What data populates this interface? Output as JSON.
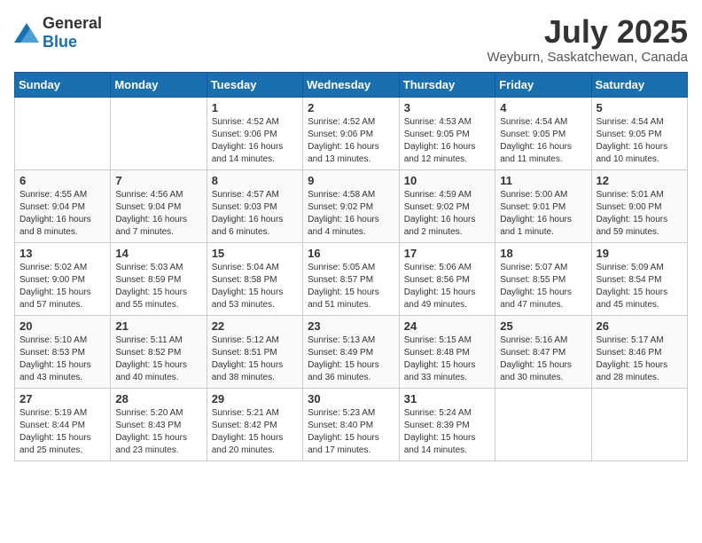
{
  "logo": {
    "general": "General",
    "blue": "Blue"
  },
  "title": "July 2025",
  "location": "Weyburn, Saskatchewan, Canada",
  "days_of_week": [
    "Sunday",
    "Monday",
    "Tuesday",
    "Wednesday",
    "Thursday",
    "Friday",
    "Saturday"
  ],
  "weeks": [
    [
      {
        "day": "",
        "info": ""
      },
      {
        "day": "",
        "info": ""
      },
      {
        "day": "1",
        "info": "Sunrise: 4:52 AM\nSunset: 9:06 PM\nDaylight: 16 hours and 14 minutes."
      },
      {
        "day": "2",
        "info": "Sunrise: 4:52 AM\nSunset: 9:06 PM\nDaylight: 16 hours and 13 minutes."
      },
      {
        "day": "3",
        "info": "Sunrise: 4:53 AM\nSunset: 9:05 PM\nDaylight: 16 hours and 12 minutes."
      },
      {
        "day": "4",
        "info": "Sunrise: 4:54 AM\nSunset: 9:05 PM\nDaylight: 16 hours and 11 minutes."
      },
      {
        "day": "5",
        "info": "Sunrise: 4:54 AM\nSunset: 9:05 PM\nDaylight: 16 hours and 10 minutes."
      }
    ],
    [
      {
        "day": "6",
        "info": "Sunrise: 4:55 AM\nSunset: 9:04 PM\nDaylight: 16 hours and 8 minutes."
      },
      {
        "day": "7",
        "info": "Sunrise: 4:56 AM\nSunset: 9:04 PM\nDaylight: 16 hours and 7 minutes."
      },
      {
        "day": "8",
        "info": "Sunrise: 4:57 AM\nSunset: 9:03 PM\nDaylight: 16 hours and 6 minutes."
      },
      {
        "day": "9",
        "info": "Sunrise: 4:58 AM\nSunset: 9:02 PM\nDaylight: 16 hours and 4 minutes."
      },
      {
        "day": "10",
        "info": "Sunrise: 4:59 AM\nSunset: 9:02 PM\nDaylight: 16 hours and 2 minutes."
      },
      {
        "day": "11",
        "info": "Sunrise: 5:00 AM\nSunset: 9:01 PM\nDaylight: 16 hours and 1 minute."
      },
      {
        "day": "12",
        "info": "Sunrise: 5:01 AM\nSunset: 9:00 PM\nDaylight: 15 hours and 59 minutes."
      }
    ],
    [
      {
        "day": "13",
        "info": "Sunrise: 5:02 AM\nSunset: 9:00 PM\nDaylight: 15 hours and 57 minutes."
      },
      {
        "day": "14",
        "info": "Sunrise: 5:03 AM\nSunset: 8:59 PM\nDaylight: 15 hours and 55 minutes."
      },
      {
        "day": "15",
        "info": "Sunrise: 5:04 AM\nSunset: 8:58 PM\nDaylight: 15 hours and 53 minutes."
      },
      {
        "day": "16",
        "info": "Sunrise: 5:05 AM\nSunset: 8:57 PM\nDaylight: 15 hours and 51 minutes."
      },
      {
        "day": "17",
        "info": "Sunrise: 5:06 AM\nSunset: 8:56 PM\nDaylight: 15 hours and 49 minutes."
      },
      {
        "day": "18",
        "info": "Sunrise: 5:07 AM\nSunset: 8:55 PM\nDaylight: 15 hours and 47 minutes."
      },
      {
        "day": "19",
        "info": "Sunrise: 5:09 AM\nSunset: 8:54 PM\nDaylight: 15 hours and 45 minutes."
      }
    ],
    [
      {
        "day": "20",
        "info": "Sunrise: 5:10 AM\nSunset: 8:53 PM\nDaylight: 15 hours and 43 minutes."
      },
      {
        "day": "21",
        "info": "Sunrise: 5:11 AM\nSunset: 8:52 PM\nDaylight: 15 hours and 40 minutes."
      },
      {
        "day": "22",
        "info": "Sunrise: 5:12 AM\nSunset: 8:51 PM\nDaylight: 15 hours and 38 minutes."
      },
      {
        "day": "23",
        "info": "Sunrise: 5:13 AM\nSunset: 8:49 PM\nDaylight: 15 hours and 36 minutes."
      },
      {
        "day": "24",
        "info": "Sunrise: 5:15 AM\nSunset: 8:48 PM\nDaylight: 15 hours and 33 minutes."
      },
      {
        "day": "25",
        "info": "Sunrise: 5:16 AM\nSunset: 8:47 PM\nDaylight: 15 hours and 30 minutes."
      },
      {
        "day": "26",
        "info": "Sunrise: 5:17 AM\nSunset: 8:46 PM\nDaylight: 15 hours and 28 minutes."
      }
    ],
    [
      {
        "day": "27",
        "info": "Sunrise: 5:19 AM\nSunset: 8:44 PM\nDaylight: 15 hours and 25 minutes."
      },
      {
        "day": "28",
        "info": "Sunrise: 5:20 AM\nSunset: 8:43 PM\nDaylight: 15 hours and 23 minutes."
      },
      {
        "day": "29",
        "info": "Sunrise: 5:21 AM\nSunset: 8:42 PM\nDaylight: 15 hours and 20 minutes."
      },
      {
        "day": "30",
        "info": "Sunrise: 5:23 AM\nSunset: 8:40 PM\nDaylight: 15 hours and 17 minutes."
      },
      {
        "day": "31",
        "info": "Sunrise: 5:24 AM\nSunset: 8:39 PM\nDaylight: 15 hours and 14 minutes."
      },
      {
        "day": "",
        "info": ""
      },
      {
        "day": "",
        "info": ""
      }
    ]
  ]
}
